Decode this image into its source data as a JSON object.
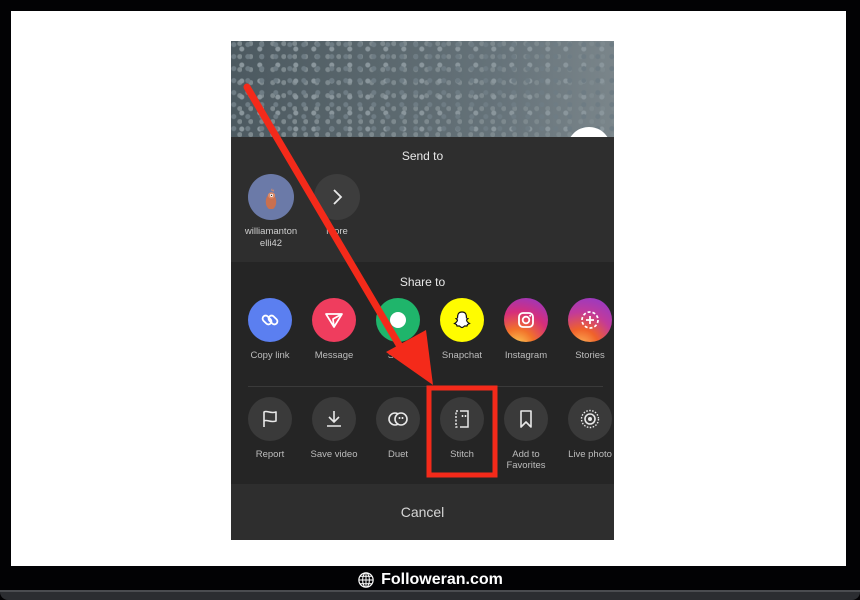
{
  "brand": {
    "name": "Followeran.com",
    "icon": "globe-icon"
  },
  "sheet": {
    "send_to": {
      "title": "Send to",
      "contacts": [
        {
          "label": "williamanton\nelli42",
          "line1": "williamanton",
          "line2": "elli42",
          "icon": "avatar"
        },
        {
          "label": "More",
          "icon": "chevron-right-icon"
        }
      ]
    },
    "share_to": {
      "title": "Share to",
      "items": [
        {
          "label": "Copy link",
          "icon": "link-icon",
          "color": "#5b7ff0"
        },
        {
          "label": "Message",
          "icon": "send-icon",
          "color": "#ef3d5e"
        },
        {
          "label": "SMS",
          "icon": "sms-icon",
          "color": "#1fb56b"
        },
        {
          "label": "Snapchat",
          "icon": "snapchat-icon",
          "color": "#fffc00"
        },
        {
          "label": "Instagram",
          "icon": "instagram-icon",
          "color": "#d62e7a"
        },
        {
          "label": "Stories",
          "icon": "stories-icon",
          "color": "#a33bd1"
        }
      ]
    },
    "actions": [
      {
        "label": "Report",
        "icon": "flag-icon"
      },
      {
        "label": "Save video",
        "icon": "download-icon"
      },
      {
        "label": "Duet",
        "icon": "duet-icon"
      },
      {
        "label": "Stitch",
        "icon": "stitch-icon",
        "highlighted": true
      },
      {
        "label": "Add to Favorites",
        "line1": "Add to",
        "line2": "Favorites",
        "icon": "bookmark-icon"
      },
      {
        "label": "Live photo",
        "icon": "live-photo-icon"
      }
    ],
    "cancel_label": "Cancel"
  },
  "annotation": {
    "arrow_color": "#f42a1a",
    "highlight_color": "#f42a1a",
    "highlight_target": "Stitch"
  }
}
